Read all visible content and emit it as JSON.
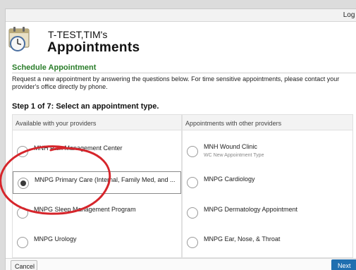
{
  "topbar": {
    "logout_label": "Log O"
  },
  "header": {
    "patient_name": "T-TEST,TIM's",
    "title": "Appointments",
    "icon": "calendar-clock-icon"
  },
  "section": {
    "title": "Schedule Appointment",
    "intro": "Request a new appointment by answering the questions below. For time sensitive appointments, please contact your provider's office directly by phone."
  },
  "step": {
    "label": "Step 1 of 7: Select an appointment type."
  },
  "columns": {
    "left": {
      "heading": "Available with your providers",
      "options": [
        {
          "label": "MNH Pain Management Center",
          "selected": false
        },
        {
          "label": "MNPG Primary Care (Internal, Family Med, and ...",
          "selected": true
        },
        {
          "label": "MNPG Sleep Management Program",
          "selected": false
        },
        {
          "label": "MNPG Urology",
          "selected": false
        }
      ]
    },
    "right": {
      "heading": "Appointments with other providers",
      "options": [
        {
          "label": "MNH Wound Clinic",
          "sublabel": "WC New Appointment Type",
          "selected": false
        },
        {
          "label": "MNPG Cardiology",
          "selected": false
        },
        {
          "label": "MNPG Dermatology Appointment",
          "selected": false
        },
        {
          "label": "MNPG Ear, Nose, & Throat",
          "selected": false
        }
      ]
    }
  },
  "footer": {
    "cancel_label": "Cancel",
    "next_label": "Next"
  },
  "colors": {
    "section_title": "#2a7d2a",
    "next_button": "#1f6fb0",
    "annotation_circle": "#d6252b"
  }
}
